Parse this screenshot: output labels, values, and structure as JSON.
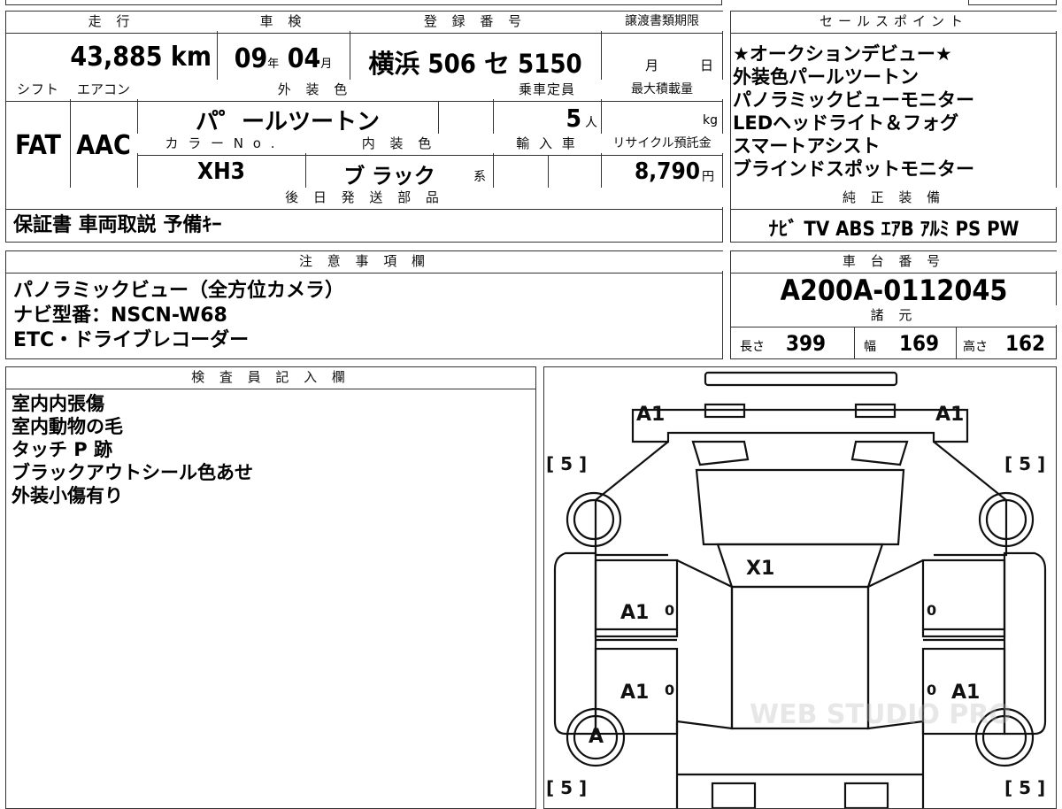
{
  "top": {
    "h_mileage": "走 行",
    "mileage": "43,885 km",
    "h_inspection": "車 検",
    "insp_year": "09",
    "insp_year_unit": "年",
    "insp_month": "04",
    "insp_month_unit": "月",
    "h_reg": "登 録 番 号",
    "reg_number": "横浜 506 セ 5150",
    "h_transfer": "譲渡書類期限",
    "transfer_month": "月",
    "transfer_day": "日",
    "h_shift": "シフト",
    "h_aircon": "エアコン",
    "h_exterior": "外 装 色",
    "h_capacity": "乗車定員",
    "h_maxload": "最大積載量",
    "shift": "FAT",
    "aircon": "AAC",
    "exterior": "パ゜ールツートン",
    "capacity": "5",
    "capacity_unit": "人",
    "maxload_unit": "kg",
    "h_colorno": "カ ラ ー N o .",
    "h_interior": "内 装 色",
    "h_import": "輸 入 車",
    "h_recycle": "リサイクル預託金",
    "colorno": "XH3",
    "interior": "ブ ラック",
    "interior_suffix": "系",
    "recycle": "8,790",
    "recycle_unit": "円",
    "h_later": "後 日 発 送 部 品",
    "later_items": "保証書 車両取説 予備ｷｰ"
  },
  "sales": {
    "header": "セールスポイント",
    "items": [
      "★オークションデビュー★",
      "外装色パールツートン",
      "パノラミックビューモニター",
      "LEDヘッドライト＆フォグ",
      "スマートアシスト",
      "ブラインドスポットモニター"
    ],
    "equip_header": "純 正 装 備",
    "equip": "ﾅﾋﾞ TV ABS ｴｱB ｱﾙﾐ PS PW"
  },
  "notes": {
    "header": "注 意 事 項 欄",
    "lines": [
      "パノラミックビュー（全方位カメラ）",
      "ナビ型番：NSCN-W68",
      "ETC・ドライブレコーダー"
    ]
  },
  "chassis": {
    "header": "車 台 番 号",
    "number": "A200A-0112045",
    "spec_header": "諸 元",
    "len_label": "長さ",
    "len": "399",
    "wid_label": "幅",
    "wid": "169",
    "hei_label": "高さ",
    "hei": "162"
  },
  "inspector": {
    "header": "検 査 員 記 入 欄",
    "lines": [
      "室内内張傷",
      "室内動物の毛",
      "タッチ P 跡",
      "ブラックアウトシール色あせ",
      "外装小傷有り"
    ]
  },
  "diagram": {
    "tl": "A1",
    "tr": "A1",
    "center": "X1",
    "ml": "A1",
    "bl": "A1",
    "br": "A1",
    "wheel": "A",
    "zero": "0",
    "tyre_tl": "[ 5 ]",
    "tyre_tr": "[ 5 ]",
    "tyre_bl": "[ 5 ]",
    "tyre_br": "[ 5 ]",
    "watermark": "WEB STUDIO PRO"
  }
}
